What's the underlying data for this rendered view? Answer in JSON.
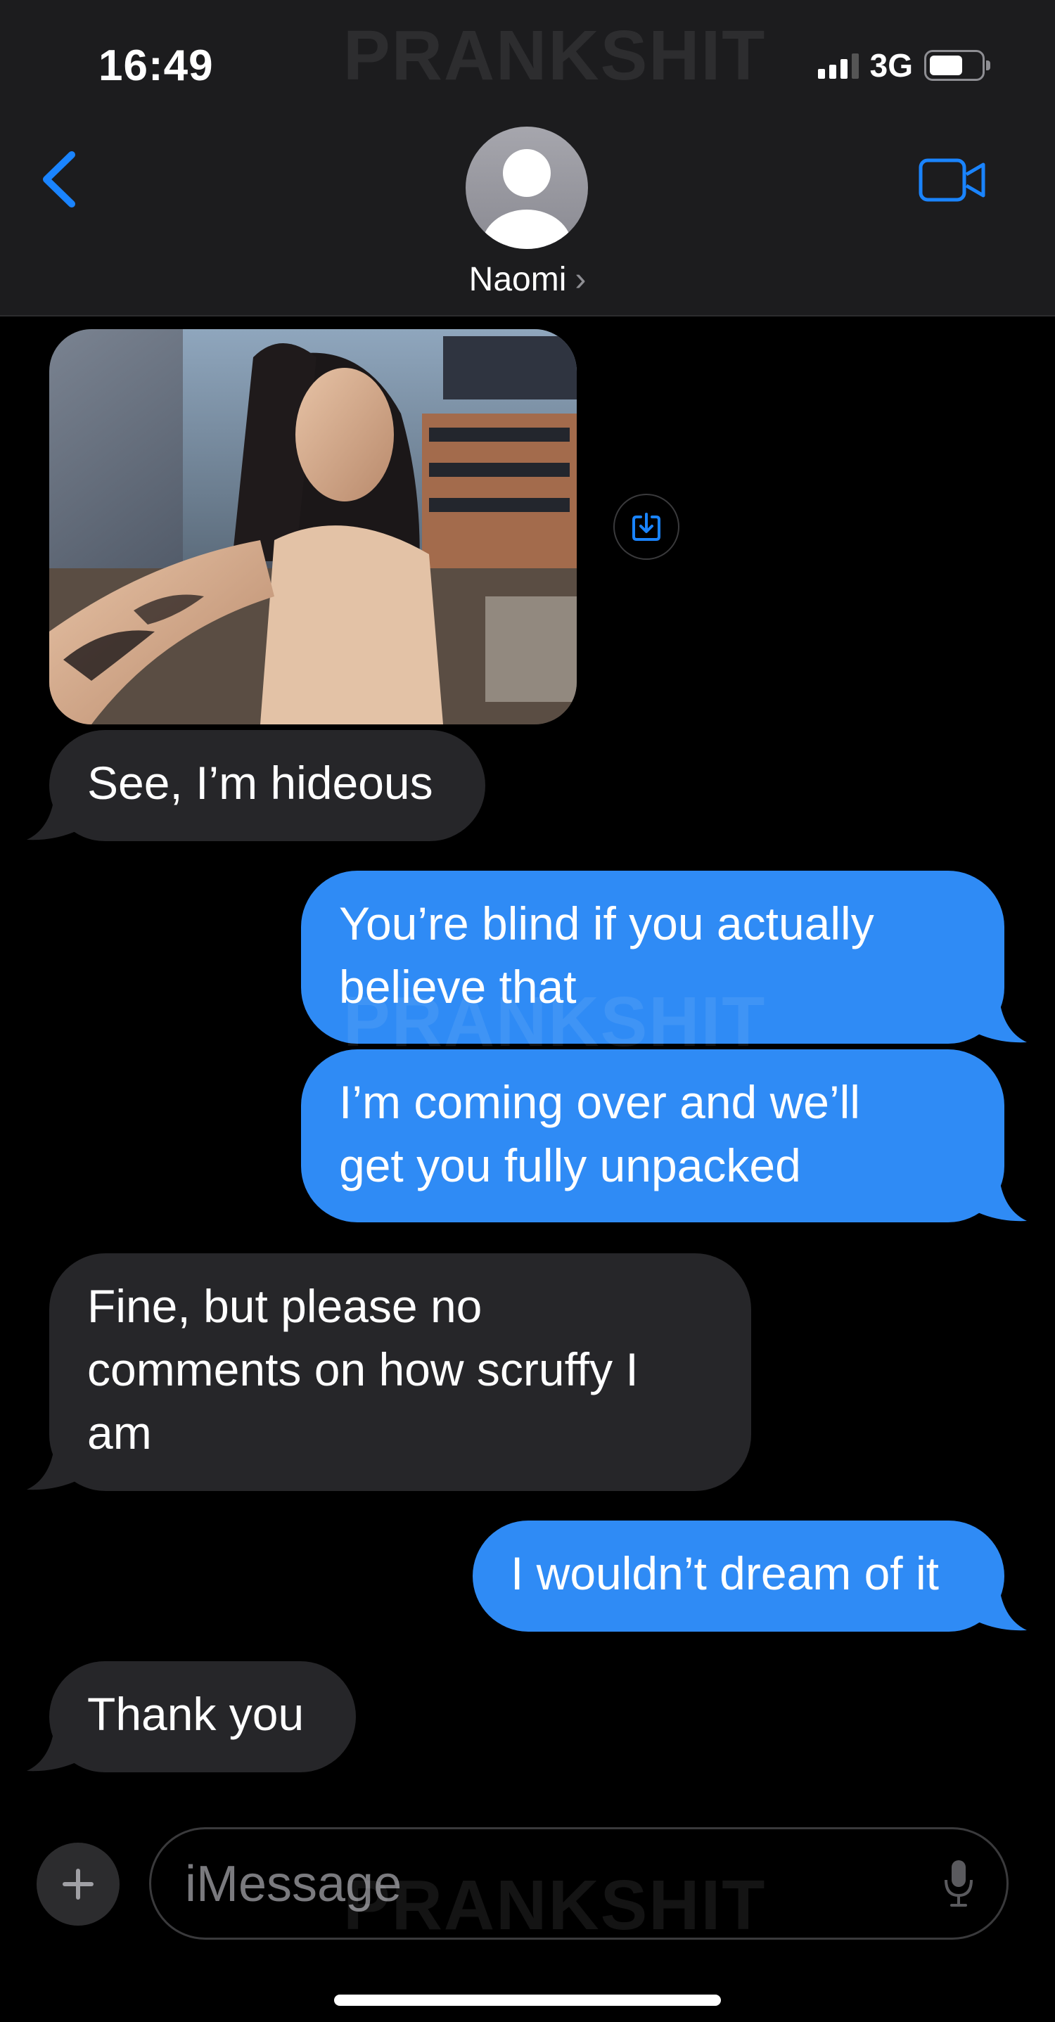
{
  "status": {
    "time": "16:49",
    "network": "3G",
    "battery": 0.65
  },
  "header": {
    "contact_name": "Naomi",
    "chevron": "›",
    "back_icon": "chevron-left-icon",
    "video_icon": "video-camera-icon"
  },
  "watermark": "PRANKSHIT",
  "messages": [
    {
      "side": "incoming",
      "text": "See, I’m hideous"
    },
    {
      "side": "outgoing",
      "lines": [
        "You’re blind if you actually",
        "believe that"
      ]
    },
    {
      "side": "outgoing",
      "lines": [
        "I’m coming over and we’ll",
        "get you fully unpacked"
      ]
    },
    {
      "side": "incoming",
      "lines": [
        "Fine, but please no",
        "comments on how scruffy I",
        "am"
      ]
    },
    {
      "side": "outgoing",
      "text": "I wouldn’t dream of it"
    },
    {
      "side": "incoming",
      "text": "Thank you"
    }
  ],
  "composer": {
    "placeholder": "iMessage",
    "plus_icon": "plus-icon",
    "mic_icon": "microphone-icon"
  },
  "colors": {
    "outgoing": "#2f8bf5",
    "incoming": "#262629",
    "accent": "#1a84ff",
    "background": "#000000"
  }
}
